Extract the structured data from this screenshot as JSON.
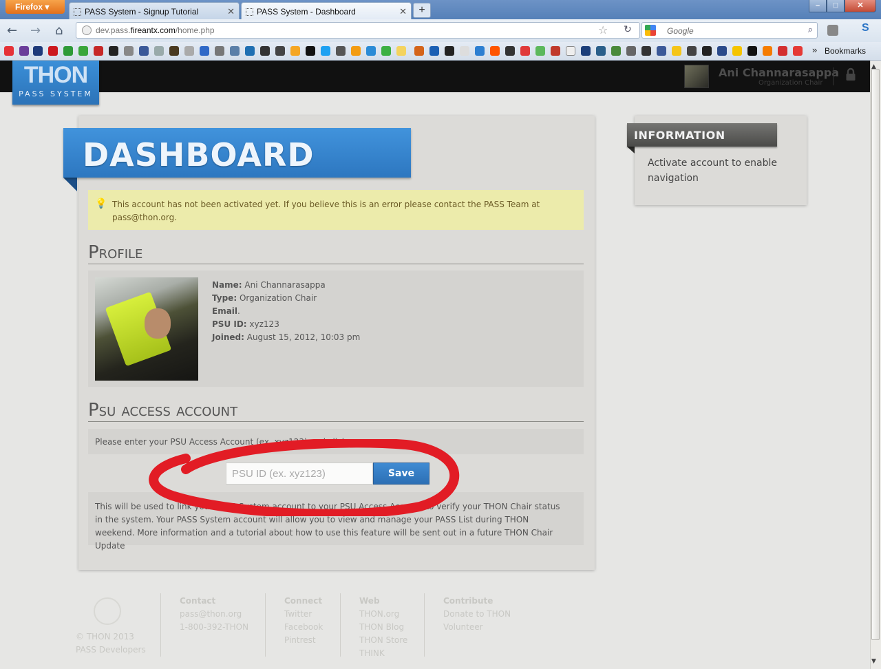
{
  "browser": {
    "menu_label": "Firefox",
    "tabs": [
      {
        "title": "PASS System - Signup Tutorial"
      },
      {
        "title": "PASS System - Dashboard"
      }
    ],
    "new_tab_label": "+",
    "url_prefix": "dev.pass.",
    "url_domain": "fireantx.com",
    "url_path": "/home.php",
    "search_placeholder": "Google",
    "bookmarks_label": "Bookmarks",
    "bookmarks_overflow": "»"
  },
  "header": {
    "logo_title": "THON",
    "logo_subtitle": "PASS SYSTEM",
    "user_name": "Ani Channarasappa",
    "user_role": "Organization Chair"
  },
  "dashboard": {
    "title": "DASHBOARD",
    "alert": "This account has not been activated yet. If you believe this is an error please contact the PASS Team at pass@thon.org."
  },
  "profile": {
    "section_title": "Profile",
    "fields": [
      {
        "label": "Name:",
        "value": "Ani Channarasappa"
      },
      {
        "label": "Type:",
        "value": "Organization Chair"
      },
      {
        "label": "Email",
        "value": "."
      },
      {
        "label": "PSU ID:",
        "value": "xyz123"
      },
      {
        "label": "Joined:",
        "value": "August 15, 2012, 10:03 pm"
      }
    ]
  },
  "psu_access": {
    "section_title": "Psu access account",
    "instructions": "Please enter your PSU Access Account (ex. xyz123) and click save.",
    "input_placeholder": "PSU ID (ex. xyz123)",
    "save_label": "Save",
    "info": "This will be used to link your PASS System account to your PSU Access Account to verify your THON Chair status in the system. Your PASS System account will allow you to view and manage your PASS List during THON weekend. More information and a tutorial about how to use this feature will be sent out in a future THON Chair Update"
  },
  "sidebar": {
    "title": "INFORMATION",
    "text": "Activate account to enable navigation"
  },
  "footer": {
    "copyright": "© THON 2013",
    "developers": "PASS Developers",
    "columns": [
      {
        "heading": "Contact",
        "items": [
          "pass@thon.org",
          "1-800-392-THON"
        ]
      },
      {
        "heading": "Connect",
        "items": [
          "Twitter",
          "Facebook",
          "Pintrest"
        ]
      },
      {
        "heading": "Web",
        "items": [
          "THON.org",
          "THON Blog",
          "THON Store",
          "THINK"
        ]
      },
      {
        "heading": "Contribute",
        "items": [
          "Donate to THON",
          "Volunteer"
        ]
      }
    ]
  },
  "colors": {
    "brand_blue": "#3b8fd8",
    "alert_bg": "#ecebab",
    "annotation_red": "#e21c25"
  }
}
